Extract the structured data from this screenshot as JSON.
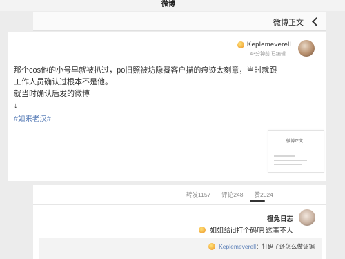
{
  "status_bar": {
    "title": "微博"
  },
  "header": {
    "title": "微博正文",
    "back_icon": "back-chevron-icon"
  },
  "post": {
    "author": {
      "name": "Keplemeverell",
      "badge_icon": "emoji-badge-icon",
      "meta": "43分钟前 已编辑"
    },
    "body_lines": [
      "那个cos他的小号早就被扒过，po旧照被坊隐藏客户描的痕迹太刻意，当时就跟",
      "工作人员确认过根本不是他。",
      "就当时确认后发的微博",
      "↓"
    ],
    "hashtag": "#如来老汉#",
    "attachment": {
      "title": "微博正文"
    }
  },
  "tabs": [
    {
      "label": "转发1157"
    },
    {
      "label": "评论248"
    },
    {
      "label": "赞2024",
      "active": true
    }
  ],
  "comments": [
    {
      "author": "橙兔日志",
      "text": "姐姐给id打个码吧 这事不大",
      "emoji_icon": "emoji-icon",
      "reply": {
        "author": "Keplemeverell",
        "text": "：打码了还怎么做证据",
        "emoji_icon": "laughing-emoji-icon"
      }
    }
  ],
  "colors": {
    "link_blue": "#5b7fb8",
    "text": "#333333",
    "muted": "#9a9a9a",
    "background": "#ececec"
  }
}
